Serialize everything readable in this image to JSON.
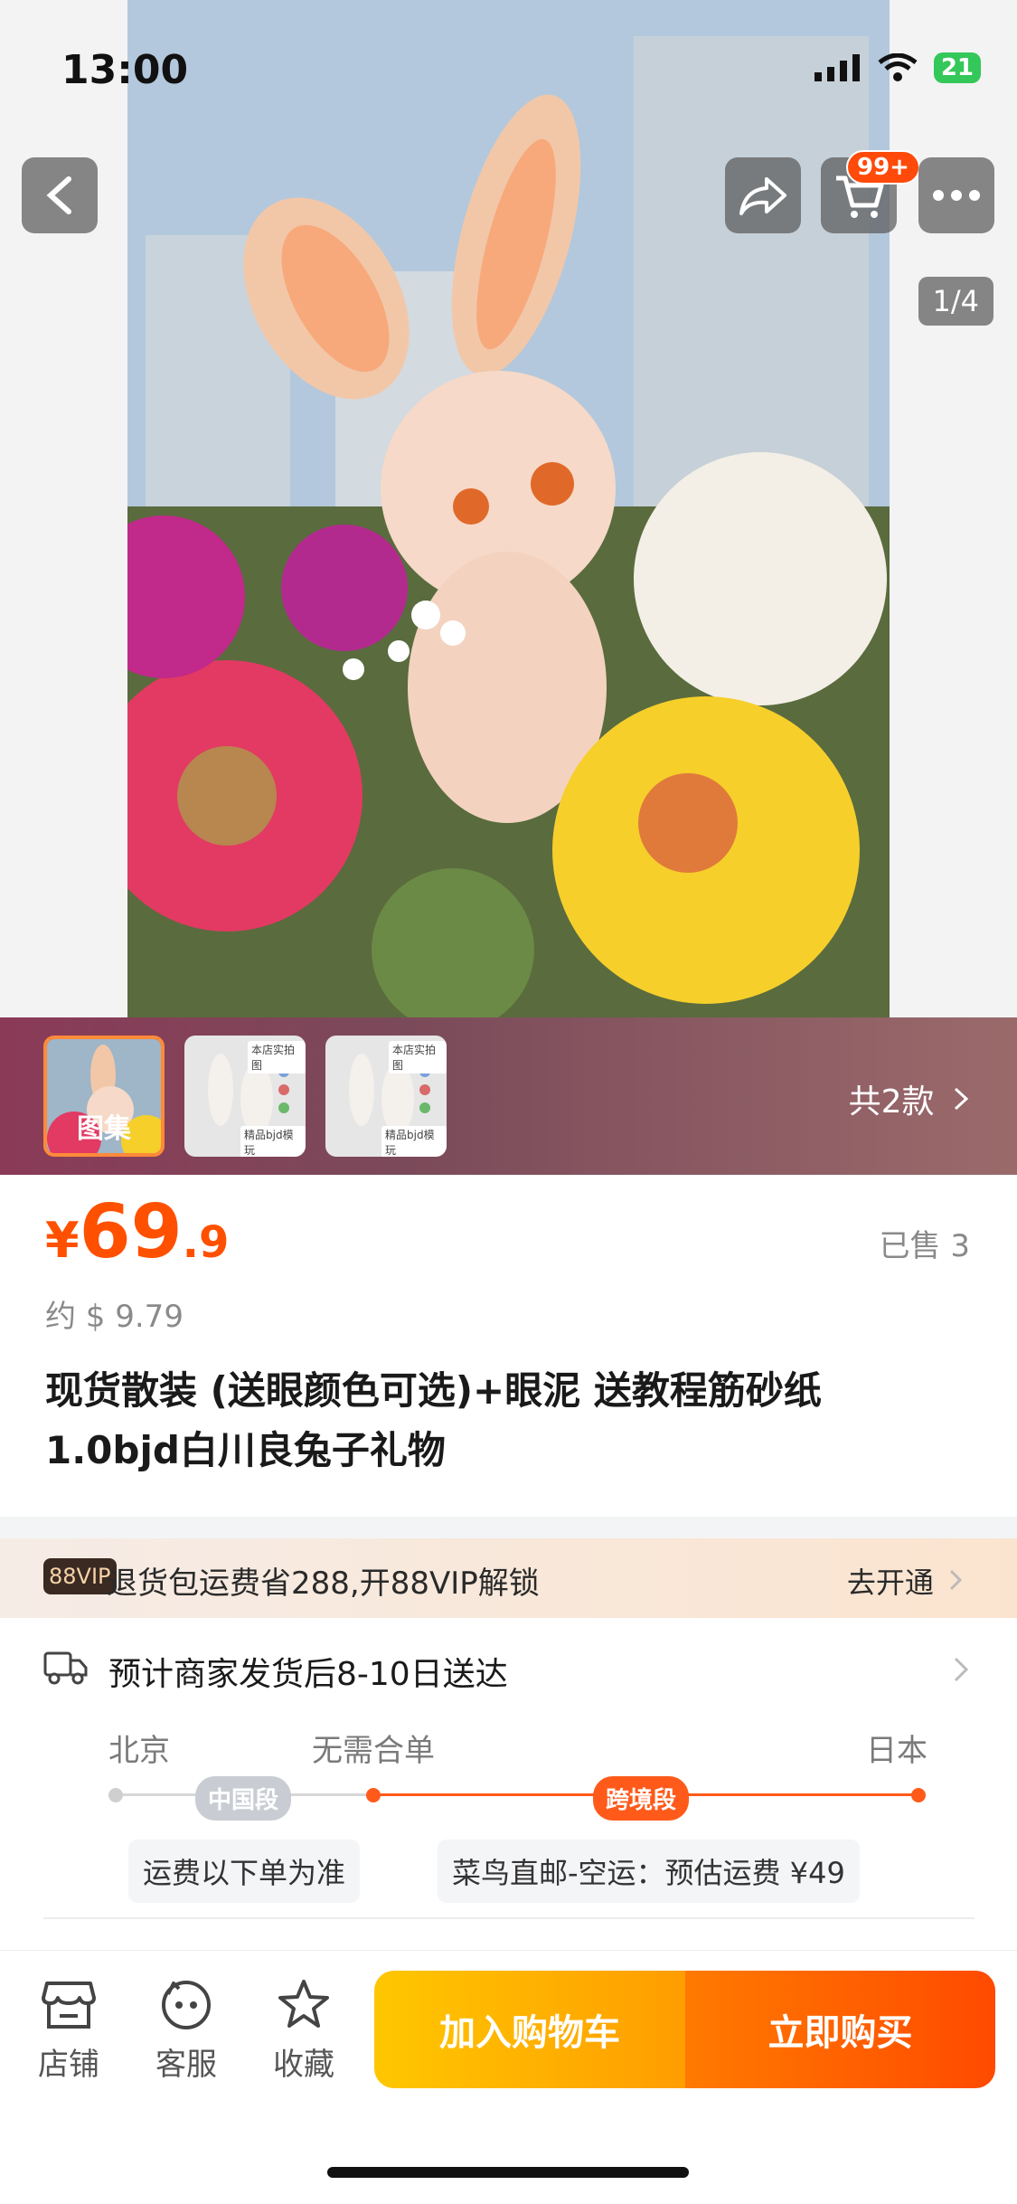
{
  "status_bar": {
    "time": "13:00",
    "battery": "21"
  },
  "hero": {
    "page_indicator": "1/4",
    "cart_badge": "99+"
  },
  "gallery": {
    "first_thumb_label": "图集",
    "thumb_caption_top": "本店实拍图",
    "thumb_caption_bottom": "精品bjd模玩",
    "variant_count": "共2款"
  },
  "product": {
    "price_symbol": "¥",
    "price_integer": "69",
    "price_decimal": ".9",
    "sold": "已售 3",
    "usd_price": "约 $ 9.79",
    "title": "现货散装 (送眼颜色可选)+眼泥 送教程筋砂纸 1.0bjd白川良兔子礼物"
  },
  "vip": {
    "tag": "88VIP",
    "text": "退货包运费省288,开88VIP解锁",
    "action": "去开通"
  },
  "shipping": {
    "title": "预计商家发货后8-10日送达",
    "origin": "北京",
    "middle": "无需合单",
    "destination": "日本",
    "domestic_segment": "中国段",
    "cross_border_segment": "跨境段",
    "domestic_note": "运费以下单为准",
    "cross_border_note": "菜鸟直邮-空运：预估运费 ¥49"
  },
  "bottom_bar": {
    "store_label": "店铺",
    "service_label": "客服",
    "favorite_label": "收藏",
    "add_to_cart": "加入购物车",
    "buy_now": "立即购买"
  },
  "colors": {
    "accent": "#ff5000",
    "cart_button": "#ffb300",
    "buy_button": "#ff5a00"
  }
}
